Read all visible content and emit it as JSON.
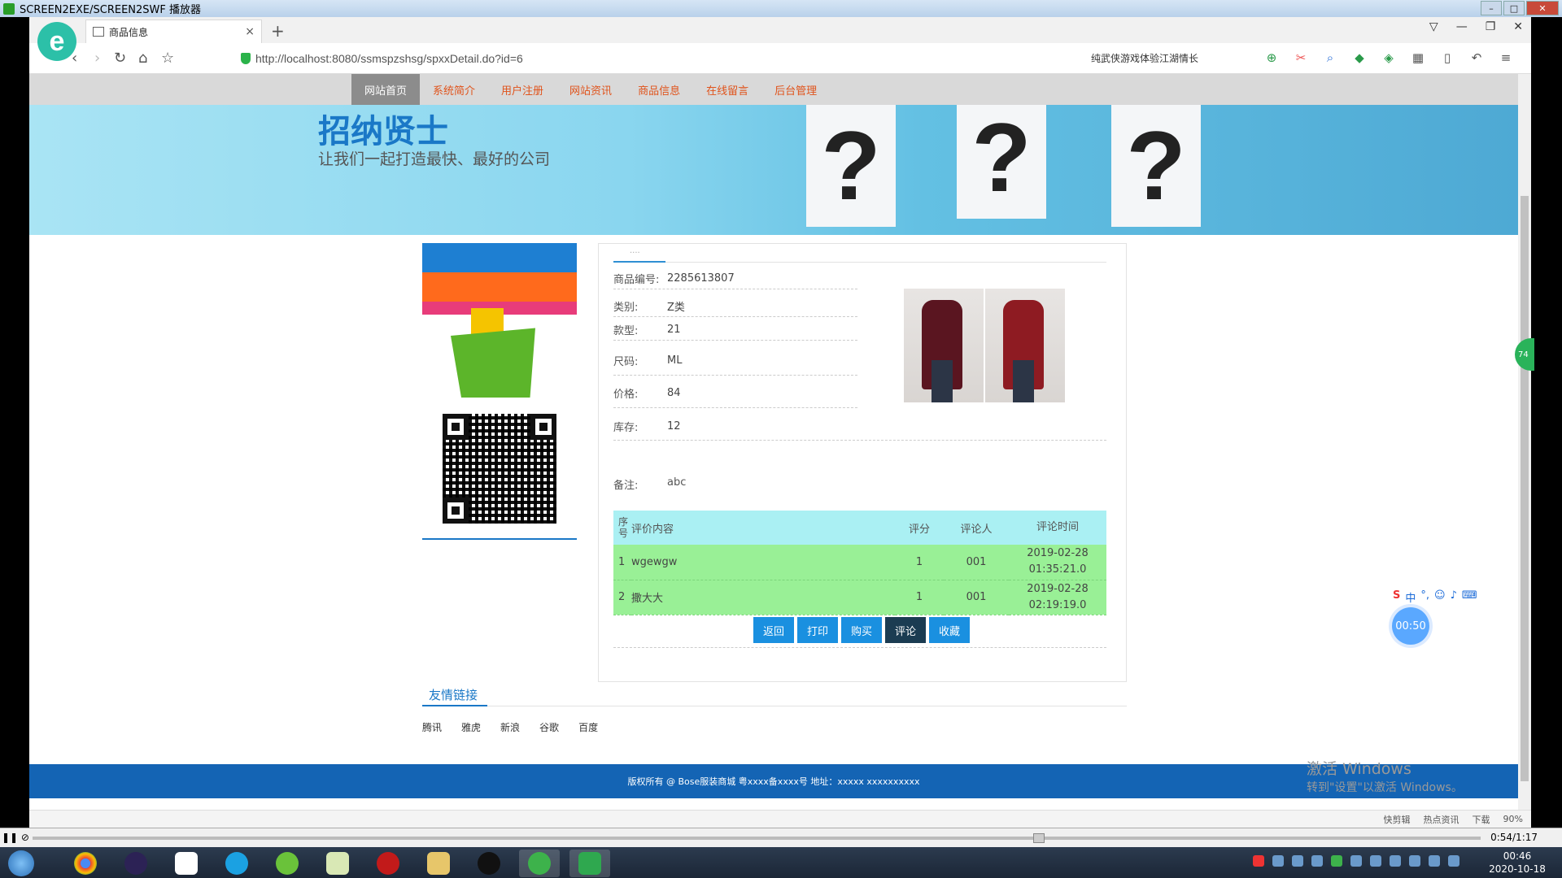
{
  "player": {
    "title": "SCREEN2EXE/SCREEN2SWF 播放器",
    "time": "0:54/1:17"
  },
  "browser": {
    "tab_title": "商品信息",
    "url": "http://localhost:8080/ssmspzshsg/spxxDetail.do?id=6",
    "search_text": "纯武侠游戏体验江湖情长",
    "status_items": [
      "快剪辑",
      "热点资讯",
      "下载",
      "90%"
    ]
  },
  "site": {
    "nav": [
      {
        "label": "网站首页",
        "active": true
      },
      {
        "label": "系统简介"
      },
      {
        "label": "用户注册"
      },
      {
        "label": "网站资讯"
      },
      {
        "label": "商品信息"
      },
      {
        "label": "在线留言"
      },
      {
        "label": "后台管理"
      }
    ],
    "banner_title": "招纳贤士",
    "banner_subtitle": "让我们一起打造最快、最好的公司",
    "banner_marks": [
      "?",
      "?",
      "?"
    ]
  },
  "detail": {
    "fields": [
      {
        "label": "商品编号:",
        "value": "2285613807"
      },
      {
        "label": "类别:",
        "value": "Z类"
      },
      {
        "label": "款型:",
        "value": "21"
      },
      {
        "label": "尺码:",
        "value": "ML"
      },
      {
        "label": "价格:",
        "value": "84"
      },
      {
        "label": "库存:",
        "value": "12"
      }
    ],
    "note_label": "备注:",
    "note_value": "abc"
  },
  "comments": {
    "headers": [
      "序号",
      "评价内容",
      "评分",
      "评论人",
      "评论时间"
    ],
    "rows": [
      {
        "no": "1",
        "content": "wgewgw",
        "score": "1",
        "user": "001",
        "date": "2019-02-28",
        "time": "01:35:21.0"
      },
      {
        "no": "2",
        "content": "撒大大",
        "score": "1",
        "user": "001",
        "date": "2019-02-28",
        "time": "02:19:19.0"
      }
    ]
  },
  "buttons": [
    "返回",
    "打印",
    "购买",
    "评论",
    "收藏"
  ],
  "links": {
    "title": "友情链接",
    "items": [
      "腾讯",
      "雅虎",
      "新浪",
      "谷歌",
      "百度"
    ]
  },
  "footer": "版权所有 @ Bose服装商城 粤xxxx备xxxx号 地址：xxxxx xxxxxxxxxx",
  "overlay": {
    "activate_title": "激活 Windows",
    "activate_sub": "转到\"设置\"以激活 Windows。",
    "timer": "00:50",
    "ime": "中",
    "side_badge": "74"
  },
  "taskbar": {
    "clock_time": "00:46",
    "clock_date": "2020-10-18"
  },
  "colors": {
    "nav_text": "#e0531b",
    "button": "#1a90e0",
    "footer": "#1464b4",
    "table_header": "#aaf0f3",
    "table_row": "#99f096"
  }
}
